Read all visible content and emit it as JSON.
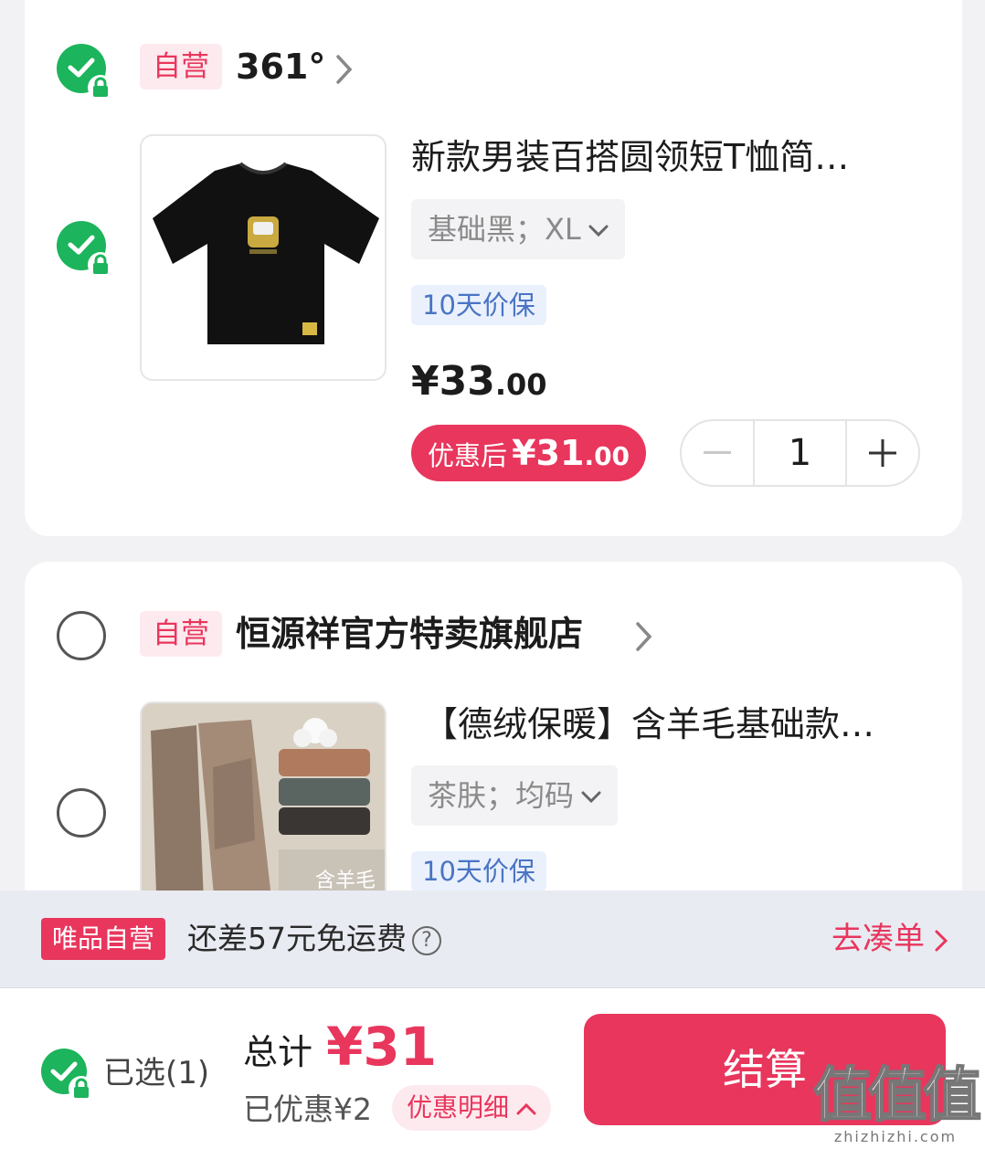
{
  "stores": [
    {
      "self_tag": "自营",
      "name": "361°",
      "product": {
        "title": "新款男装百搭圆领短T恤简…",
        "spec": "基础黑；XL",
        "guarantee": "10天价保",
        "price_int": "¥33",
        "price_dec": ".00",
        "discount_label": "优惠后",
        "discount_int": "¥31",
        "discount_dec": ".00",
        "quantity": "1"
      }
    },
    {
      "self_tag": "自营",
      "name": "恒源祥官方特卖旗舰店",
      "product": {
        "title": "【德绒保暖】含羊毛基础款…",
        "spec": "茶肤；均码",
        "guarantee": "10天价保",
        "image_text": "含羊毛"
      }
    }
  ],
  "shipping": {
    "tag": "唯品自营",
    "text": "还差57元免运费",
    "help": "?",
    "link": "去凑单"
  },
  "footer": {
    "selected": "已选(1)",
    "total_label": "总计",
    "total_amount": "¥31",
    "saved": "已优惠¥2",
    "detail": "优惠明细",
    "checkout": "结算"
  },
  "watermark": {
    "logo": "值值值",
    "site": "zhizhizhi.com"
  },
  "colors": {
    "accent": "#e8365d",
    "check": "#1cb45c",
    "guarantee": "#4a74c4"
  }
}
